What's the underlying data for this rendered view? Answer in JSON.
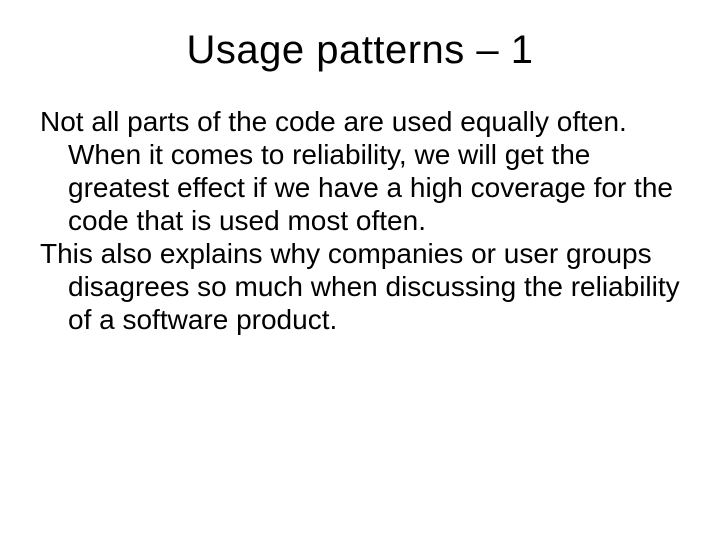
{
  "slide": {
    "title": "Usage patterns – 1",
    "paragraphs": [
      "Not all parts of the code are used equally often. When it comes to reliability, we will get the greatest effect if we have a high coverage for the code that is used most often.",
      "This also explains why companies or user groups disagrees so much when discussing the reliability of a software product."
    ]
  }
}
